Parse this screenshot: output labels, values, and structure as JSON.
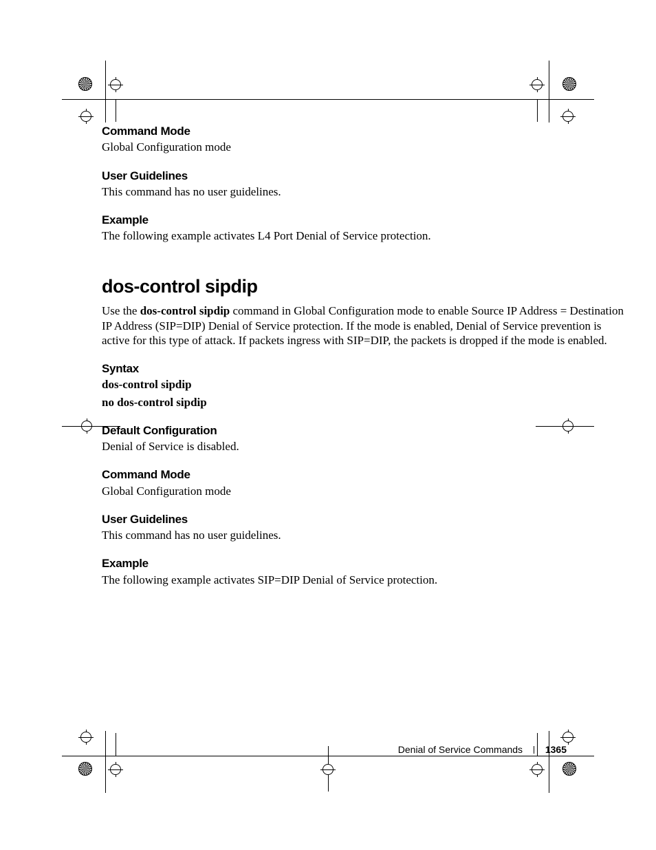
{
  "sections": [
    {
      "heading": "Command Mode",
      "body": "Global Configuration mode"
    },
    {
      "heading": "User Guidelines",
      "body": "This command has no user guidelines."
    },
    {
      "heading": "Example",
      "body": "The following example activates L4 Port Denial of Service protection."
    }
  ],
  "command": {
    "title": "dos-control sipdip",
    "intro_prefix": "Use the ",
    "intro_bold": "dos-control sipdip",
    "intro_suffix": " command in Global Configuration mode to enable Source IP Address = Destination IP Address (SIP=DIP) Denial of Service protection. If the mode is enabled, Denial of Service prevention is active for this type of attack. If packets ingress with SIP=DIP, the packets is dropped if the mode is enabled.",
    "syntax_heading": "Syntax",
    "syntax_lines": [
      "dos-control sipdip",
      "no dos-control sipdip"
    ],
    "subs": [
      {
        "heading": "Default Configuration",
        "body": "Denial of Service is disabled."
      },
      {
        "heading": "Command Mode",
        "body": "Global Configuration mode"
      },
      {
        "heading": "User Guidelines",
        "body": "This command has no user guidelines."
      },
      {
        "heading": "Example",
        "body": "The following example activates SIP=DIP Denial of Service protection."
      }
    ]
  },
  "footer": {
    "chapter": "Denial of Service Commands",
    "page": "1365"
  }
}
